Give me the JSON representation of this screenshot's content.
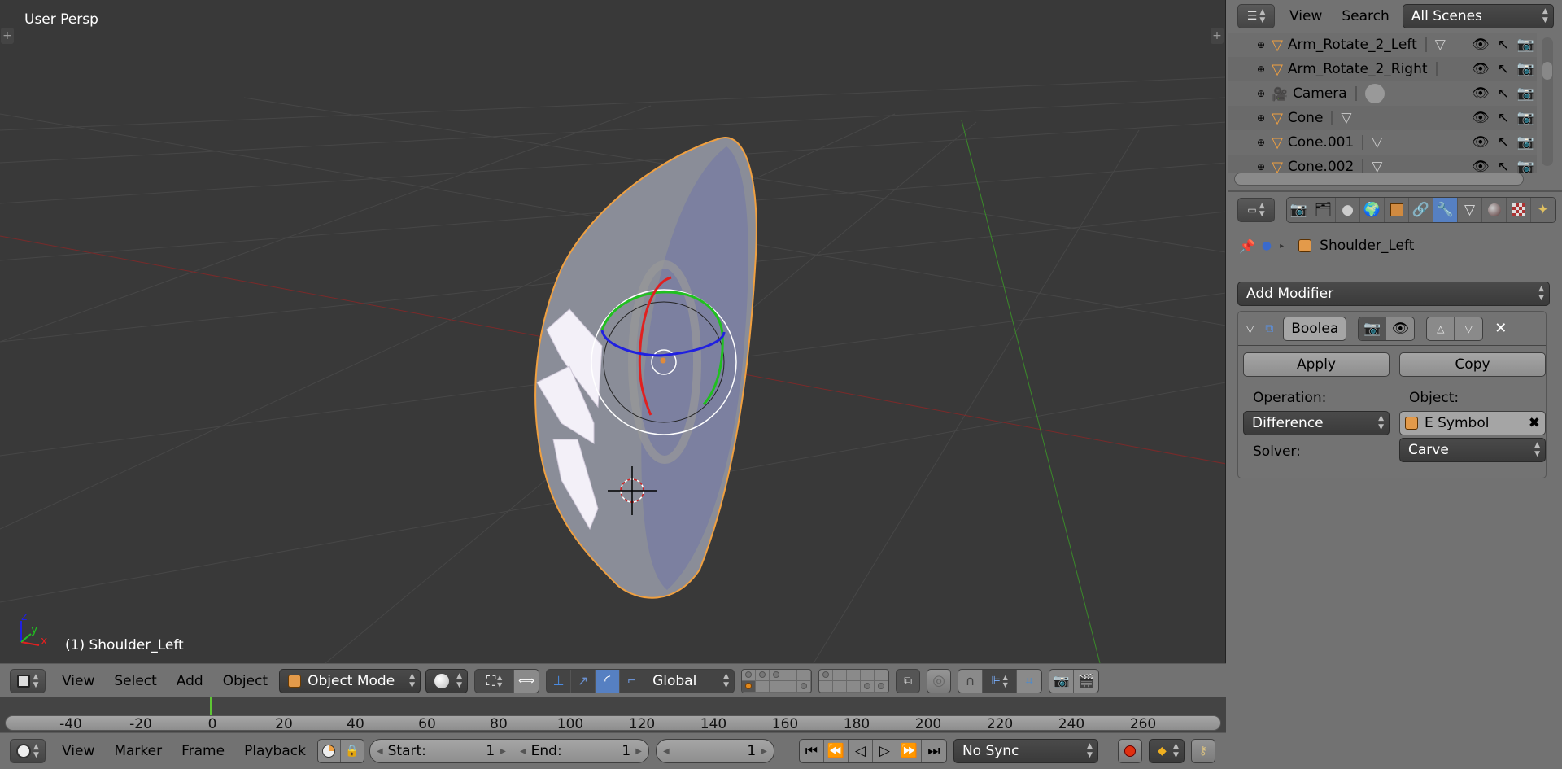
{
  "viewport": {
    "view_name": "User Persp",
    "active_object_label": "(1) Shoulder_Left",
    "axis_labels": {
      "x": "x",
      "y": "y",
      "z": "z"
    }
  },
  "view3d_header": {
    "editor_type_icon": "cube-icon",
    "menus": [
      "View",
      "Select",
      "Add",
      "Object"
    ],
    "mode": "Object Mode",
    "pivot_icon": "sphere-shading-icon",
    "transform_orientation": "Global",
    "manipulator_active": "rotate"
  },
  "timeline": {
    "ruler_ticks": [
      "-40",
      "-20",
      "0",
      "20",
      "40",
      "60",
      "80",
      "100",
      "120",
      "140",
      "160",
      "180",
      "200",
      "220",
      "240",
      "260"
    ],
    "current_frame": "1",
    "menus": [
      "View",
      "Marker",
      "Frame",
      "Playback"
    ],
    "start_label": "Start:",
    "start_value": "1",
    "end_label": "End:",
    "end_value": "1",
    "frame_value": "1",
    "sync": "No Sync"
  },
  "outliner": {
    "menus": [
      "View",
      "Search"
    ],
    "scene_filter": "All Scenes",
    "items": [
      {
        "name": "Arm_Rotate_2_Left",
        "type": "mesh"
      },
      {
        "name": "Arm_Rotate_2_Right",
        "type": "mesh"
      },
      {
        "name": "Camera",
        "type": "camera"
      },
      {
        "name": "Cone",
        "type": "mesh"
      },
      {
        "name": "Cone.001",
        "type": "mesh"
      },
      {
        "name": "Cone.002",
        "type": "mesh"
      }
    ]
  },
  "properties": {
    "active_tab": "modifiers",
    "tabs": [
      "render",
      "render-layers",
      "scene",
      "world",
      "object",
      "constraints",
      "modifiers",
      "data",
      "material",
      "texture",
      "particles"
    ],
    "context_object": "Shoulder_Left",
    "add_modifier_label": "Add Modifier",
    "modifier": {
      "name": "Boolea",
      "apply_label": "Apply",
      "copy_label": "Copy",
      "operation_label": "Operation:",
      "operation_value": "Difference",
      "object_label": "Object:",
      "object_value": "E Symbol",
      "solver_label": "Solver:",
      "solver_value": "Carve"
    }
  },
  "colors": {
    "viewport_bg": "#393939",
    "selection_outline": "#f0a040",
    "active_tab": "#5680c2",
    "current_frame": "#5ec634"
  }
}
